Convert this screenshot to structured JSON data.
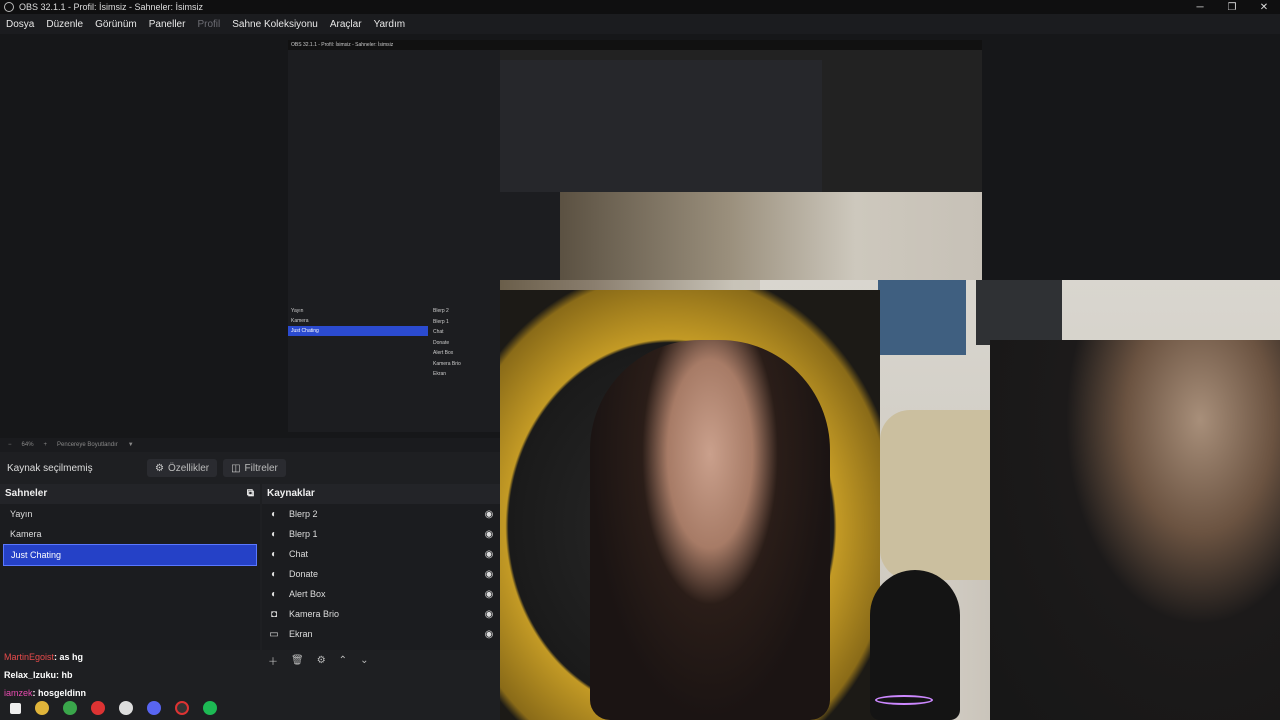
{
  "window": {
    "title": "OBS 32.1.1 - Profil: İsimsiz - Sahneler: İsimsiz",
    "controls": [
      "─",
      "❐",
      "✕"
    ]
  },
  "menu": {
    "items": [
      {
        "label": "Dosya",
        "enabled": true
      },
      {
        "label": "Düzenle",
        "enabled": true
      },
      {
        "label": "Görünüm",
        "enabled": true
      },
      {
        "label": "Paneller",
        "enabled": true
      },
      {
        "label": "Profil",
        "enabled": false
      },
      {
        "label": "Sahne Koleksiyonu",
        "enabled": true
      },
      {
        "label": "Araçlar",
        "enabled": true
      },
      {
        "label": "Yardım",
        "enabled": true
      }
    ]
  },
  "preview": {
    "zoom": "64%",
    "fit_label": "Pencereye Boyutlandır"
  },
  "props_bar": {
    "no_source": "Kaynak seçilmemiş",
    "properties": "Özellikler",
    "filters": "Filtreler"
  },
  "scenes": {
    "title": "Sahneler",
    "items": [
      {
        "label": "Yayın",
        "selected": false
      },
      {
        "label": "Kamera",
        "selected": false
      },
      {
        "label": "Just Chating",
        "selected": true
      }
    ]
  },
  "sources": {
    "title": "Kaynaklar",
    "items": [
      {
        "label": "Blerp 2",
        "icon": "globe-icon"
      },
      {
        "label": "Blerp 1",
        "icon": "globe-icon"
      },
      {
        "label": "Chat",
        "icon": "globe-icon"
      },
      {
        "label": "Donate",
        "icon": "globe-icon"
      },
      {
        "label": "Alert Box",
        "icon": "globe-icon"
      },
      {
        "label": "Kamera Brio",
        "icon": "camera-icon"
      },
      {
        "label": "Ekran",
        "icon": "monitor-icon"
      }
    ]
  },
  "chat": {
    "lines": [
      {
        "user": "MartinEgoist",
        "message": ": as hg"
      },
      {
        "user": "Relax_Izuku",
        "message": ": hb"
      },
      {
        "user": "iamzek",
        "message": ": hosgeldinn"
      }
    ]
  },
  "colors": {
    "selection": "#2541c7",
    "background": "#1e1f22",
    "panel": "#1b1c1f"
  }
}
